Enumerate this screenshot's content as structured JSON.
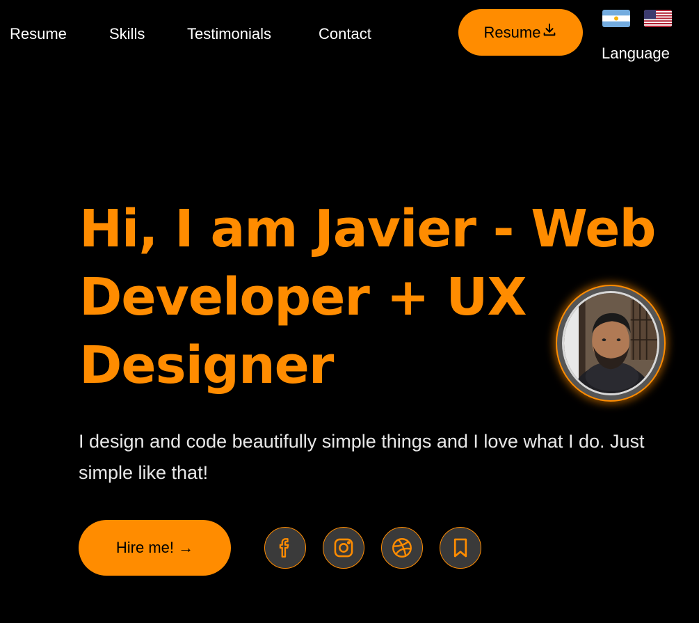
{
  "nav": {
    "links": [
      {
        "label": "Resume"
      },
      {
        "label": "Skills"
      },
      {
        "label": "Testimonials"
      },
      {
        "label": "Contact"
      }
    ],
    "resume_button": {
      "label": "Resume",
      "icon": "download-icon"
    },
    "language": {
      "label": "Language",
      "flags": [
        "argentina-flag-icon",
        "usa-flag-icon"
      ]
    }
  },
  "hero": {
    "title": "Hi, I am Javier - Web Developer + UX Designer",
    "subtitle": "I design and code beautifully simple things and I love what I do. Just simple like that!",
    "hire_button": {
      "label": "Hire me!  →"
    },
    "social_icons": [
      "facebook-icon",
      "instagram-icon",
      "dribbble-icon",
      "bookmark-icon"
    ]
  },
  "colors": {
    "background": "#000000",
    "accent": "#ff8c00",
    "text": "#ffffff",
    "social_bg": "#3a3a3a"
  }
}
